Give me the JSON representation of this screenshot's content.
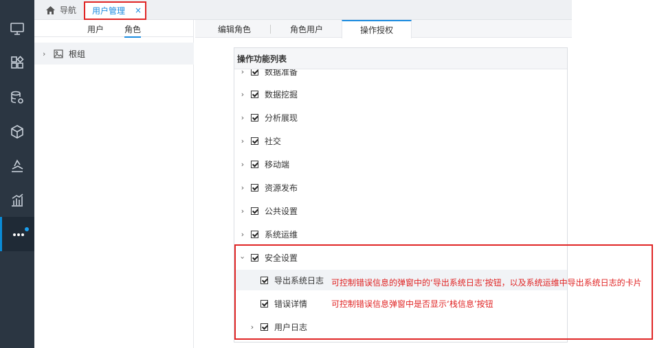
{
  "sidebar": {
    "icons": [
      "monitor-icon",
      "dashboard-grid-icon",
      "database-gear-icon",
      "cube-icon",
      "layers-chart-icon",
      "bar-chart-icon",
      "more-icon"
    ],
    "active_index": 6
  },
  "topbar": {
    "nav_label": "导航",
    "active_tab": "用户管理",
    "close": "×"
  },
  "left_panel": {
    "tabs": [
      "用户",
      "角色"
    ],
    "selected_tab": "角色",
    "tree": {
      "root_label": "根组",
      "root_icon": "image-icon"
    }
  },
  "right_tabs": [
    "编辑角色",
    "角色用户",
    "操作授权"
  ],
  "right_tabs_selected": "操作授权",
  "func_list": {
    "header": "操作功能列表",
    "items": [
      {
        "label": "数据准备",
        "checked": true,
        "expander": "collapsed"
      },
      {
        "label": "数据挖掘",
        "checked": true,
        "expander": "collapsed"
      },
      {
        "label": "分析展现",
        "checked": true,
        "expander": "collapsed"
      },
      {
        "label": "社交",
        "checked": true,
        "expander": "collapsed"
      },
      {
        "label": "移动端",
        "checked": true,
        "expander": "collapsed"
      },
      {
        "label": "资源发布",
        "checked": true,
        "expander": "collapsed"
      },
      {
        "label": "公共设置",
        "checked": true,
        "expander": "collapsed"
      },
      {
        "label": "系统运维",
        "checked": true,
        "expander": "collapsed"
      },
      {
        "label": "安全设置",
        "checked": true,
        "expander": "expanded"
      },
      {
        "label": "导出系统日志",
        "checked": true,
        "expander": "none",
        "level": 2
      },
      {
        "label": "错误详情",
        "checked": true,
        "expander": "none",
        "level": 2
      },
      {
        "label": "用户日志",
        "checked": true,
        "expander": "collapsed",
        "level": 2
      }
    ]
  },
  "annotations": {
    "export_log_note": "可控制错误信息的弹窗中的‘导出系统日志‘按钮，以及系统运维中导出系统日志的卡片",
    "error_detail_note": "可控制错误信息弹窗中是否显示‘栈信息’按钮"
  },
  "colors": {
    "sidebar_bg": "#2b3642",
    "accent": "#1a8be0",
    "annotation_red": "#e02424"
  }
}
